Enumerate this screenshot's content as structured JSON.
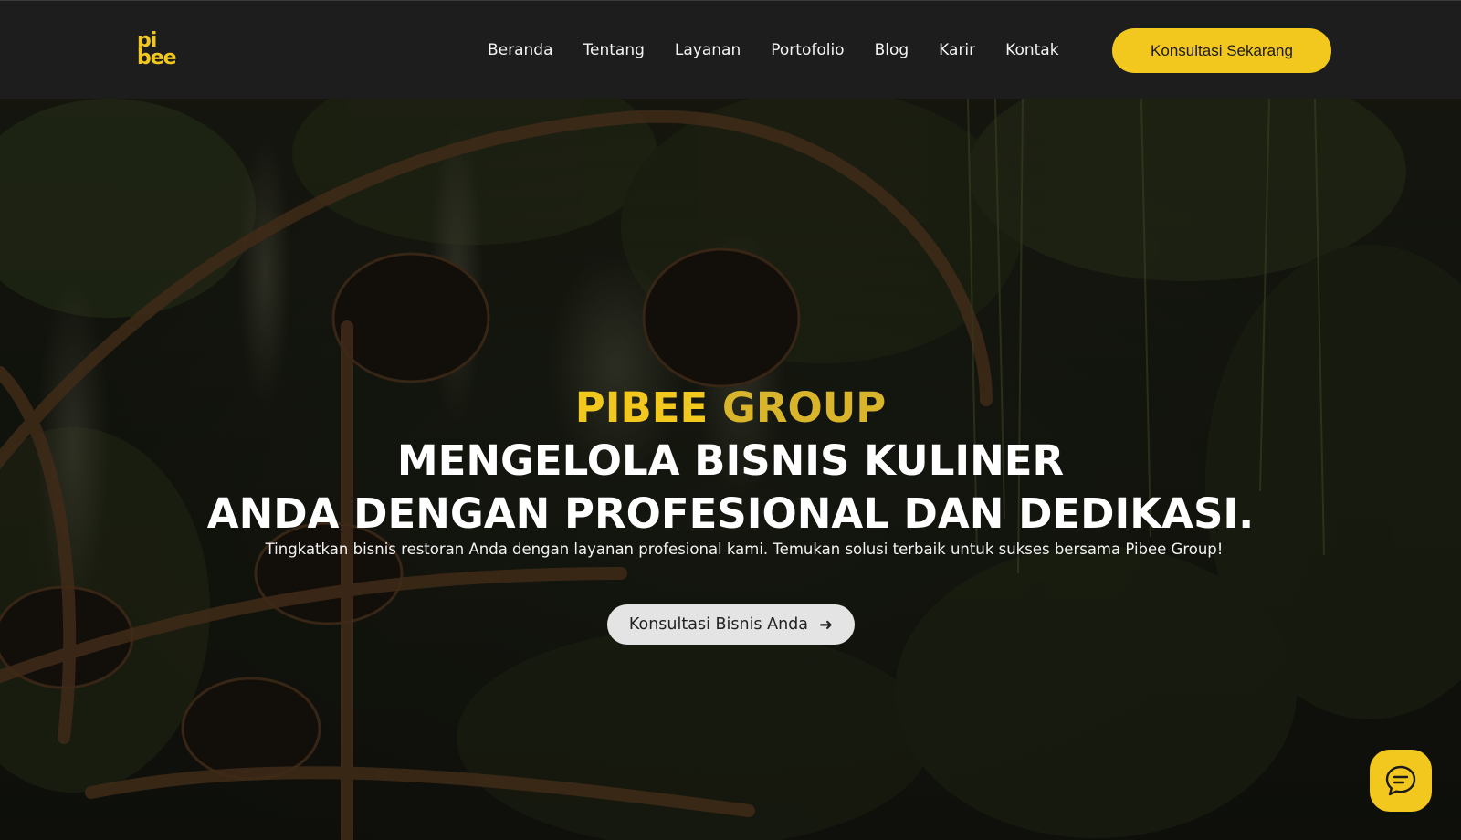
{
  "header": {
    "logo": {
      "line1": "pi",
      "line2": "bee"
    },
    "nav": [
      {
        "label": "Beranda"
      },
      {
        "label": "Tentang"
      },
      {
        "label": "Layanan"
      },
      {
        "label": "Portofolio"
      },
      {
        "label": "Blog"
      },
      {
        "label": "Karir"
      },
      {
        "label": "Kontak"
      }
    ],
    "cta_label": "Konsultasi Sekarang"
  },
  "hero": {
    "brand_part1": "PIBEE",
    "brand_part2": "GROUP",
    "headline_line1": "MENGELOLA BISNIS KULINER",
    "headline_line2": "ANDA DENGAN PROFESIONAL DAN DEDIKASI.",
    "subtext": "Tingkatkan bisnis restoran Anda dengan layanan profesional kami. Temukan solusi terbaik untuk sukses bersama Pibee Group!",
    "cta_label": "Konsultasi Bisnis Anda",
    "cta_icon": "arrow-right-icon"
  },
  "chat": {
    "icon": "chat-bubble-icon"
  },
  "colors": {
    "accent": "#f2c81e",
    "header_bg": "#1d1d1d",
    "hero_button_bg": "#e4e4e4"
  }
}
